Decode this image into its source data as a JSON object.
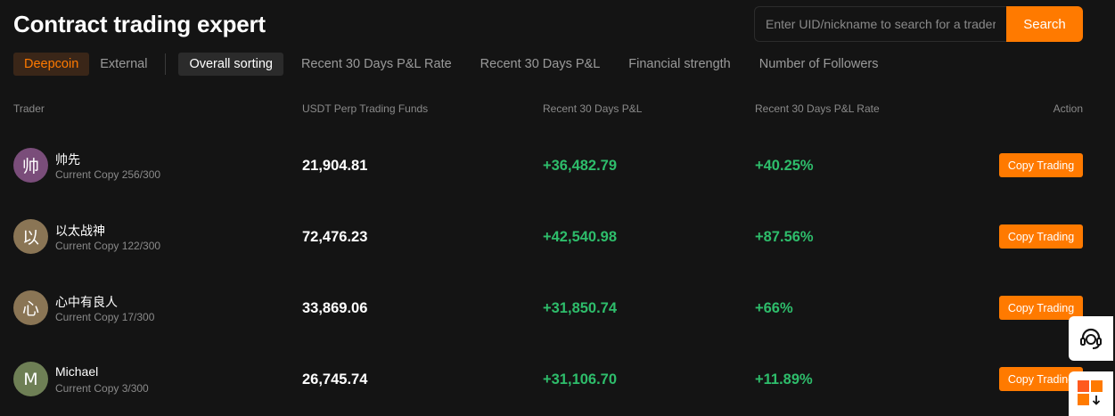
{
  "page": {
    "title": "Contract trading expert"
  },
  "search": {
    "placeholder": "Enter UID/nickname to search for a trader",
    "button_label": "Search"
  },
  "source_tabs": [
    {
      "label": "Deepcoin",
      "active": true
    },
    {
      "label": "External",
      "active": false
    }
  ],
  "sort_tabs": [
    {
      "label": "Overall sorting",
      "active": true
    },
    {
      "label": "Recent 30 Days P&L Rate",
      "active": false
    },
    {
      "label": "Recent 30 Days P&L",
      "active": false
    },
    {
      "label": "Financial strength",
      "active": false
    },
    {
      "label": "Number of Followers",
      "active": false
    }
  ],
  "table": {
    "headers": {
      "trader": "Trader",
      "funds": "USDT Perp Trading Funds",
      "pnl": "Recent 30 Days P&L",
      "rate": "Recent 30 Days P&L Rate",
      "action": "Action"
    },
    "rows": [
      {
        "avatar_text": "帅",
        "avatar_color": "#7a4d7a",
        "name": "帅先",
        "copy_info": "Current Copy 256/300",
        "funds": "21,904.81",
        "pnl": "+36,482.79",
        "rate": "+40.25%",
        "action_label": "Copy Trading"
      },
      {
        "avatar_text": "以",
        "avatar_color": "#8a7555",
        "name": "以太战神",
        "copy_info": "Current Copy 122/300",
        "funds": "72,476.23",
        "pnl": "+42,540.98",
        "rate": "+87.56%",
        "action_label": "Copy Trading"
      },
      {
        "avatar_text": "心",
        "avatar_color": "#8a7555",
        "name": "心中有良人",
        "copy_info": "Current Copy 17/300",
        "funds": "33,869.06",
        "pnl": "+31,850.74",
        "rate": "+66%",
        "action_label": "Copy Trading"
      },
      {
        "avatar_text": "M",
        "avatar_color": "#6e7f55",
        "name": "Michael",
        "copy_info": "Current Copy 3/300",
        "funds": "26,745.74",
        "pnl": "+31,106.70",
        "rate": "+11.89%",
        "action_label": "Copy Trading"
      }
    ]
  },
  "floating": {
    "support_icon": "headset-icon",
    "app_icon": "app-download-icon"
  },
  "colors": {
    "accent": "#ff7a00",
    "positive": "#2ebd6b",
    "background": "#141414"
  }
}
